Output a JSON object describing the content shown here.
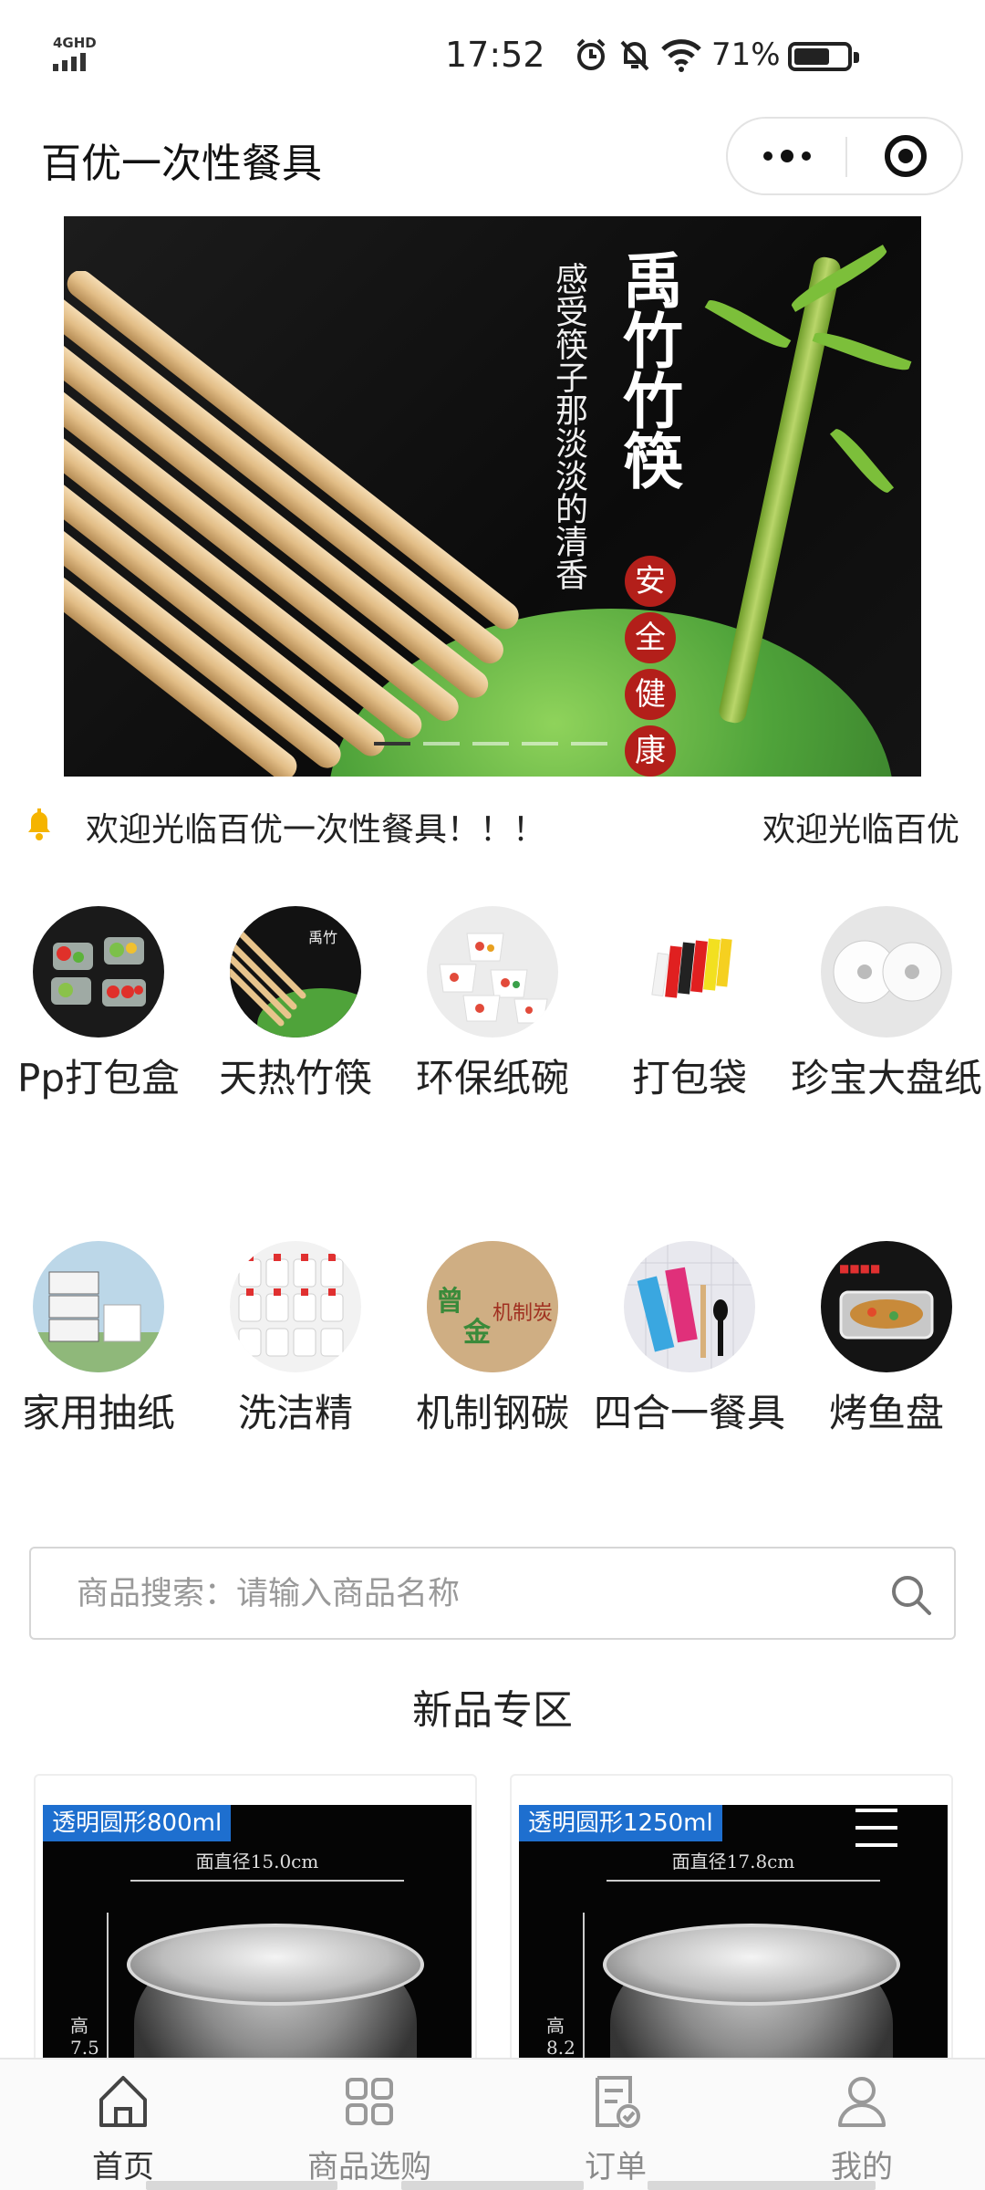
{
  "status_bar": {
    "network": "4GHD",
    "time": "17:52",
    "battery_percent": "71%",
    "battery_level": 0.71,
    "icons": [
      "alarm-icon",
      "mute-bell-icon",
      "wifi-icon"
    ]
  },
  "nav": {
    "title": "百优一次性餐具",
    "more_icon": "more-dots-icon",
    "close_icon": "target-icon"
  },
  "banner": {
    "brand_text": "禹竹竹筷",
    "slogan": "感受筷子那淡淡的清香",
    "seals": [
      "安",
      "全",
      "健",
      "康"
    ],
    "slide_count": 5,
    "active_slide": 1
  },
  "notice": {
    "icon": "bell-icon",
    "text": "欢迎光临百优一次性餐具！！！",
    "text_repeat": "欢迎光临百优"
  },
  "categories": [
    {
      "label": "Pp打包盒",
      "image": "pp-box-photo"
    },
    {
      "label": "天热竹筷",
      "image": "bamboo-chopsticks-photo"
    },
    {
      "label": "环保纸碗",
      "image": "paper-bowl-photo"
    },
    {
      "label": "打包袋",
      "image": "packing-bag-photo"
    },
    {
      "label": "珍宝大盘纸",
      "image": "jumbo-roll-photo"
    },
    {
      "label": "家用抽纸",
      "image": "tissue-photo"
    },
    {
      "label": "洗洁精",
      "image": "detergent-photo"
    },
    {
      "label": "机制钢碳",
      "image": "charcoal-box-photo"
    },
    {
      "label": "四合一餐具",
      "image": "cutlery-set-photo"
    },
    {
      "label": "烤鱼盘",
      "image": "fish-tray-photo"
    }
  ],
  "search": {
    "placeholder": "商品搜索：请输入商品名称",
    "icon": "search-icon"
  },
  "section_title": "新品专区",
  "products": [
    {
      "tag": "透明圆形800ml",
      "diameter": "面直径15.0cm",
      "height_label": "高",
      "height_value": "7.5"
    },
    {
      "tag": "透明圆形1250ml",
      "diameter": "面直径17.8cm",
      "height_label": "高",
      "height_value": "8.2"
    }
  ],
  "tabs": [
    {
      "label": "首页",
      "icon": "home-icon",
      "active": true
    },
    {
      "label": "商品选购",
      "icon": "grid-icon",
      "active": false
    },
    {
      "label": "订单",
      "icon": "order-icon",
      "active": false
    },
    {
      "label": "我的",
      "icon": "user-icon",
      "active": false
    }
  ],
  "colors": {
    "accent_seal": "#b31f1a",
    "tag_blue": "#1e6fcf",
    "bell": "#f5b400"
  }
}
